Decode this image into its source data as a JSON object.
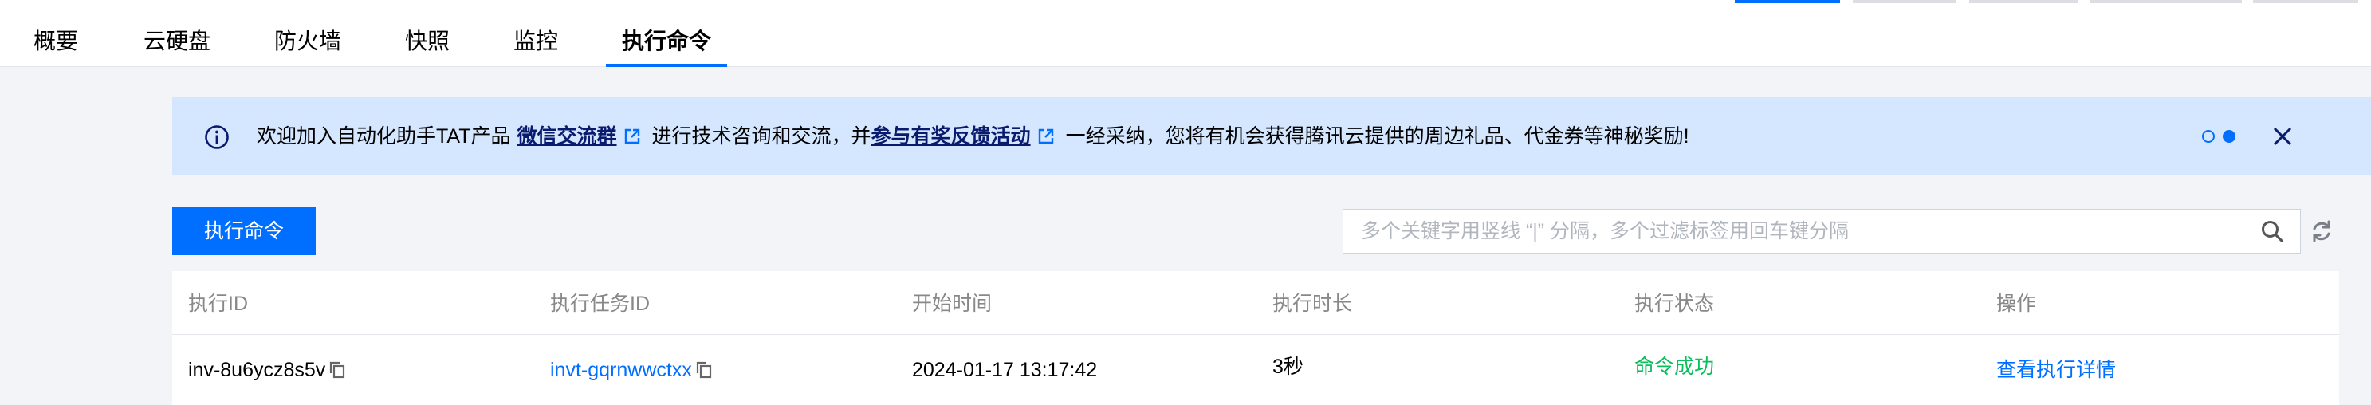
{
  "tabs": [
    {
      "label": "概要"
    },
    {
      "label": "云硬盘"
    },
    {
      "label": "防火墙"
    },
    {
      "label": "快照"
    },
    {
      "label": "监控"
    },
    {
      "label": "执行命令",
      "active": true
    }
  ],
  "banner": {
    "text_1": "欢迎加入自动化助手TAT产品",
    "link_1": "微信交流群",
    "text_2": "进行技术咨询和交流，并",
    "link_2": "参与有奖反馈活动",
    "text_3": "一经采纳，您将有机会获得腾讯云提供的周边礼品、代金券等神秘奖励!",
    "page_count": 2,
    "current_page": 2
  },
  "toolbar": {
    "run_label": "执行命令",
    "search_placeholder": "多个关键字用竖线 “|” 分隔，多个过滤标签用回车键分隔"
  },
  "table": {
    "columns": [
      "执行ID",
      "执行任务ID",
      "开始时间",
      "执行时长",
      "执行状态",
      "操作"
    ],
    "rows": [
      {
        "execution_id": "inv-8u6ycz8s5v",
        "task_id": "invt-gqrnwwctxx",
        "start_time": "2024-01-17 13:17:42",
        "duration": "3秒",
        "status": "命令成功",
        "action": "查看执行详情"
      }
    ]
  },
  "colors": {
    "primary": "#006eff",
    "banner_bg": "#d5e7ff",
    "success": "#0abf5b",
    "page_bg": "#f3f4f7"
  },
  "icons": [
    "info-icon",
    "external-link-icon",
    "close-icon",
    "search-icon",
    "refresh-icon",
    "copy-icon"
  ]
}
